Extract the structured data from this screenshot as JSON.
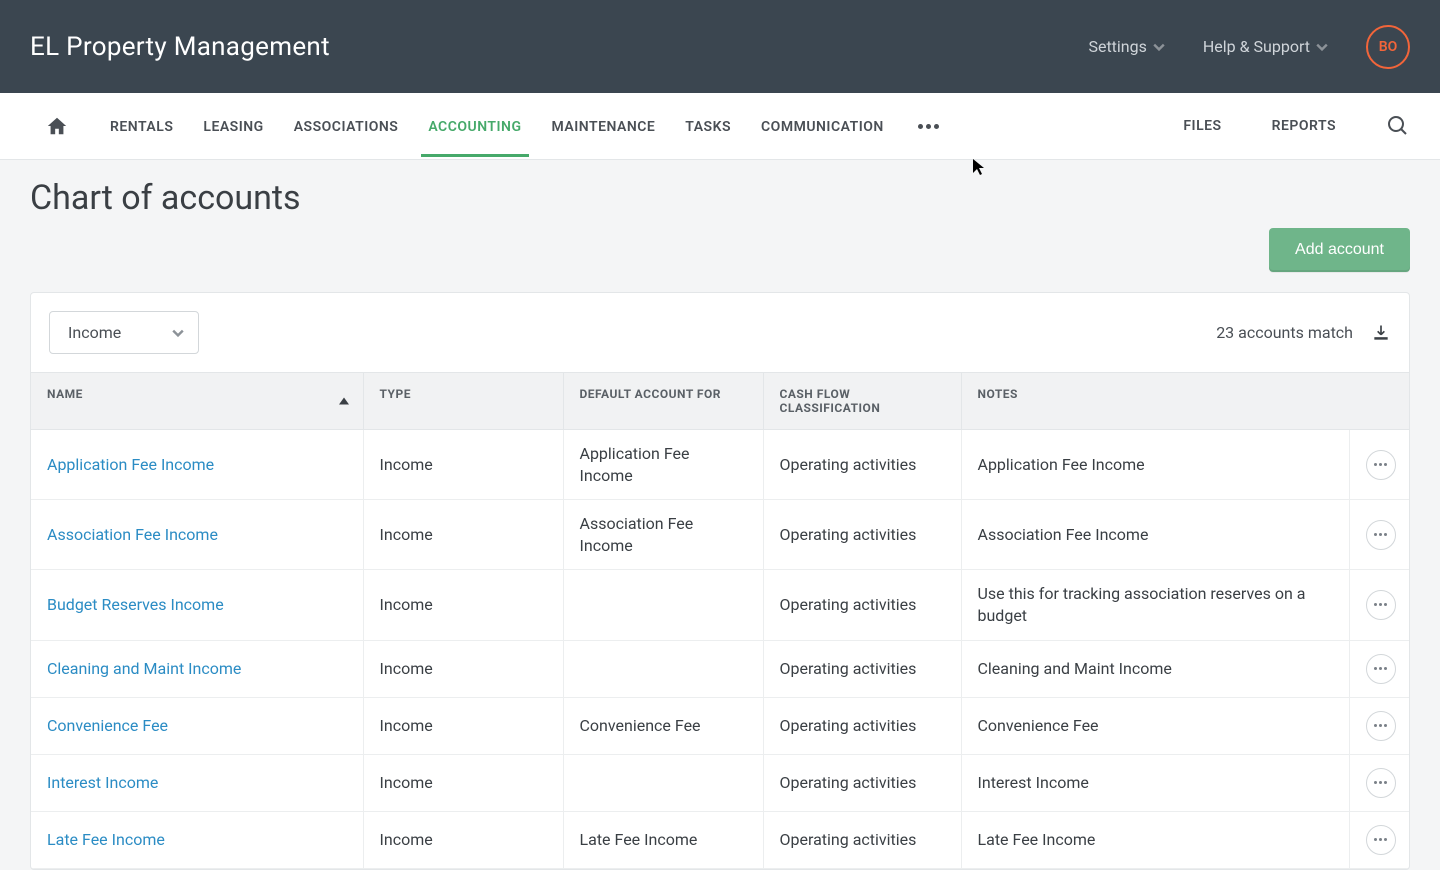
{
  "header": {
    "brand": "EL Property Management",
    "settings_label": "Settings",
    "help_label": "Help & Support",
    "avatar_initials": "BO"
  },
  "nav": {
    "tabs": [
      {
        "label": "RENTALS"
      },
      {
        "label": "LEASING"
      },
      {
        "label": "ASSOCIATIONS"
      },
      {
        "label": "ACCOUNTING",
        "active": true
      },
      {
        "label": "MAINTENANCE"
      },
      {
        "label": "TASKS"
      },
      {
        "label": "COMMUNICATION"
      }
    ],
    "right": [
      {
        "label": "FILES"
      },
      {
        "label": "REPORTS"
      }
    ]
  },
  "page": {
    "title": "Chart of accounts",
    "add_button": "Add account",
    "filter_value": "Income",
    "match_text": "23 accounts match"
  },
  "table": {
    "columns": {
      "name": "NAME",
      "type": "TYPE",
      "default_for": "DEFAULT ACCOUNT FOR",
      "cash_flow": "CASH FLOW CLASSIFICATION",
      "notes": "NOTES"
    },
    "rows": [
      {
        "name": "Application Fee Income",
        "type": "Income",
        "default_for": "Application Fee Income",
        "cash_flow": "Operating activities",
        "notes": "Application Fee Income"
      },
      {
        "name": "Association Fee Income",
        "type": "Income",
        "default_for": "Association Fee Income",
        "cash_flow": "Operating activities",
        "notes": "Association Fee Income"
      },
      {
        "name": "Budget Reserves Income",
        "type": "Income",
        "default_for": "",
        "cash_flow": "Operating activities",
        "notes": "Use this for tracking association reserves on a budget"
      },
      {
        "name": "Cleaning and Maint Income",
        "type": "Income",
        "default_for": "",
        "cash_flow": "Operating activities",
        "notes": "Cleaning and Maint Income"
      },
      {
        "name": "Convenience Fee",
        "type": "Income",
        "default_for": "Convenience Fee",
        "cash_flow": "Operating activities",
        "notes": "Convenience Fee"
      },
      {
        "name": "Interest Income",
        "type": "Income",
        "default_for": "",
        "cash_flow": "Operating activities",
        "notes": "Interest Income"
      },
      {
        "name": "Late Fee Income",
        "type": "Income",
        "default_for": "Late Fee Income",
        "cash_flow": "Operating activities",
        "notes": "Late Fee Income"
      }
    ]
  }
}
